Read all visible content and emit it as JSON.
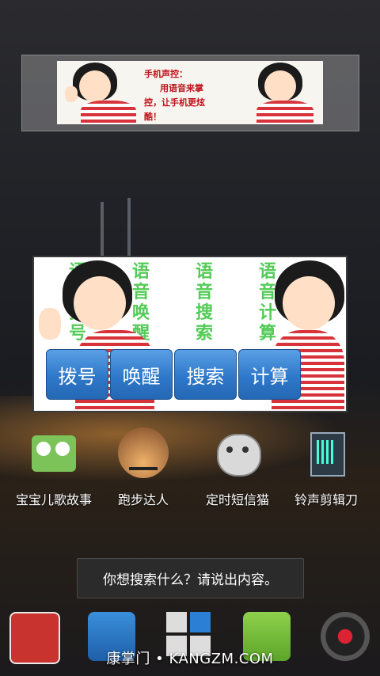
{
  "banner": {
    "text_line1": "手机声控：",
    "text_line2": "用语音来掌",
    "text_line3": "控，让手机更炫",
    "text_line4": "酷！"
  },
  "voice_widget": {
    "green_cols": [
      "语音拨号",
      "语音唤醒",
      "语音搜索",
      "语音计算"
    ],
    "buttons": {
      "dial": "拨号",
      "wake": "唤醒",
      "search": "搜索",
      "calc": "计算"
    }
  },
  "apps": [
    {
      "label": "宝宝儿歌故事",
      "icon": "kids-song-icon"
    },
    {
      "label": "跑步达人",
      "icon": "runner-icon"
    },
    {
      "label": "定时短信猫",
      "icon": "cat-icon"
    },
    {
      "label": "铃声剪辑刀",
      "icon": "ringtone-cutter-icon"
    }
  ],
  "toast": {
    "text": "你想搜索什么？请说出内容。"
  },
  "watermark": {
    "text": "康掌门 • KANGZM.COM"
  },
  "colors": {
    "button_blue": "#2f78c9",
    "green_text": "#36c23a",
    "banner_red": "#c0121b"
  }
}
